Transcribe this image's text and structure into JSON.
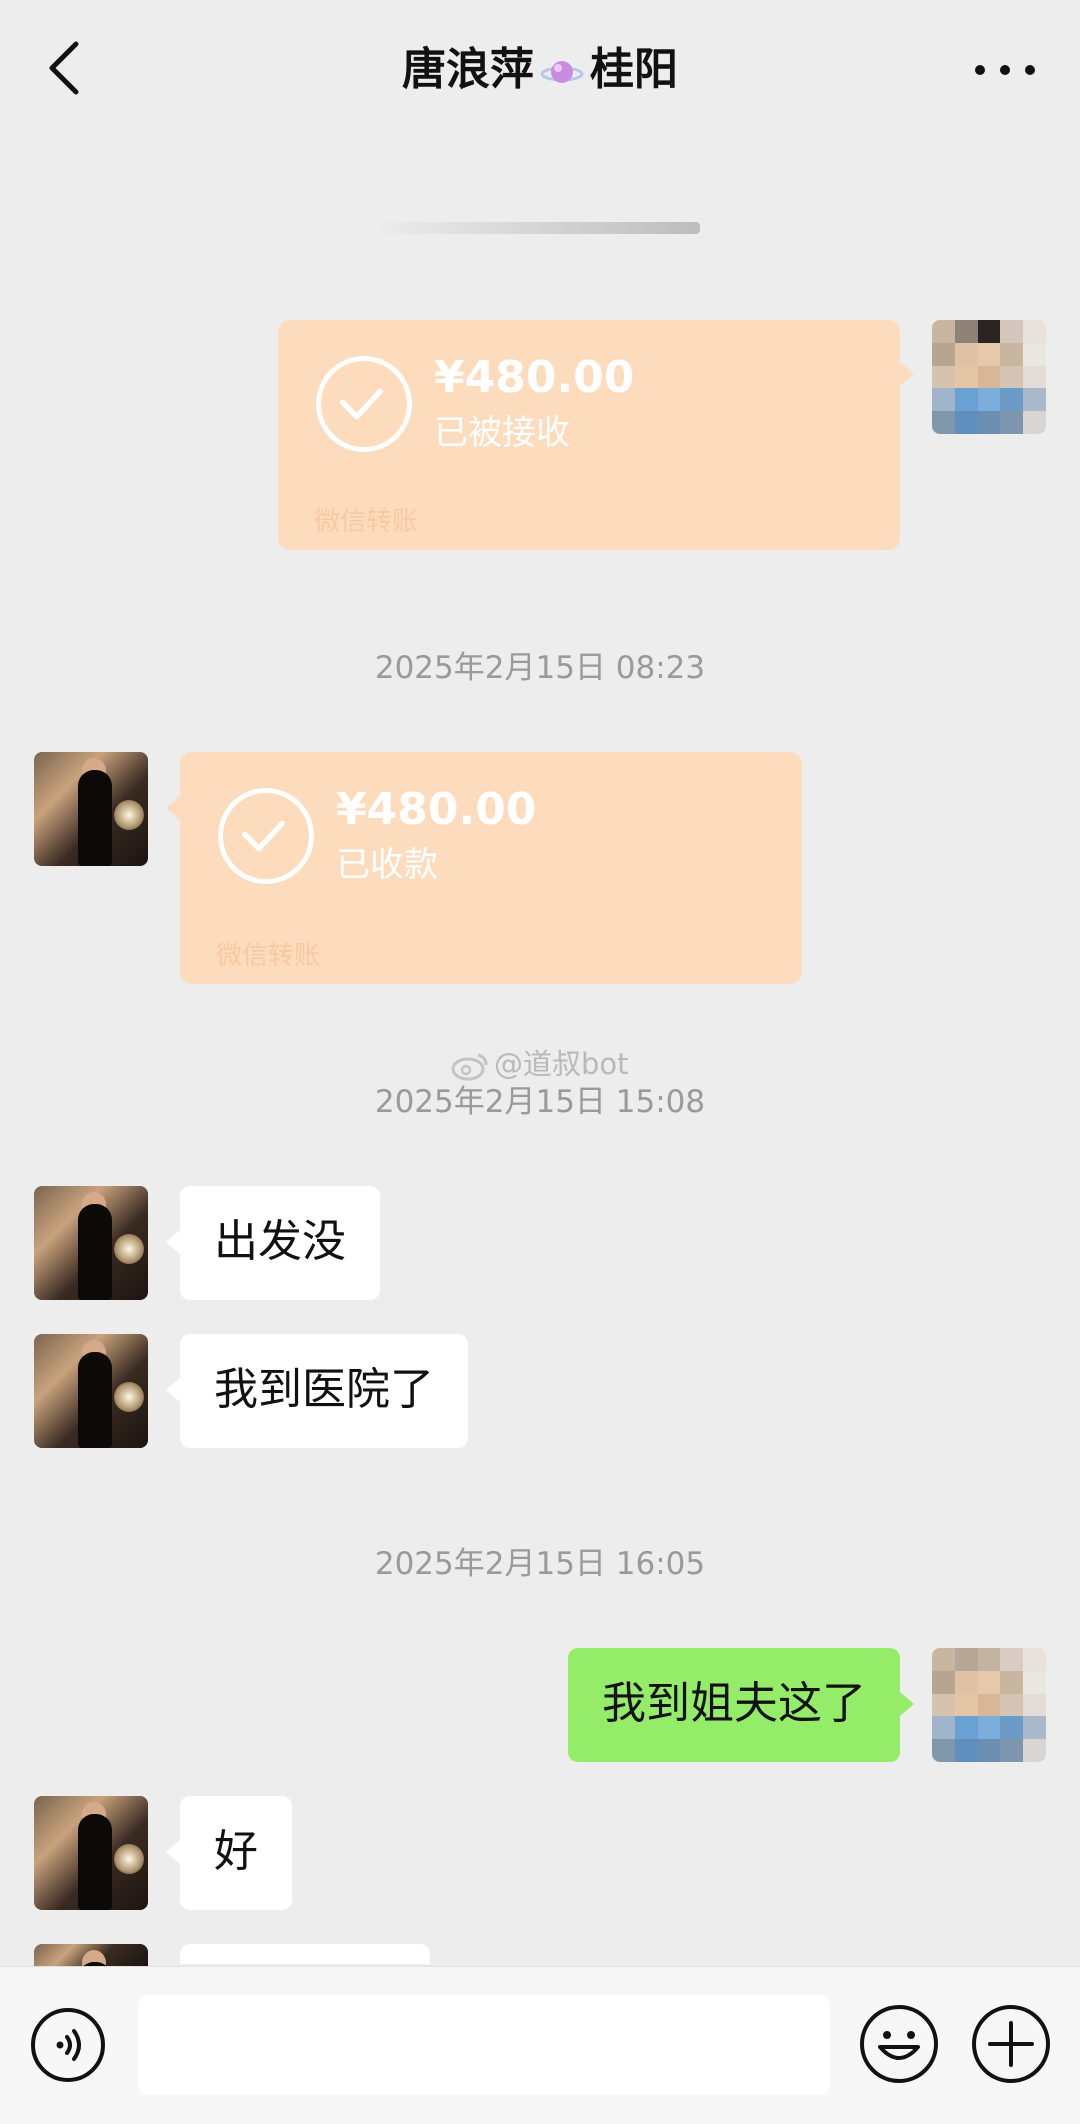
{
  "header": {
    "title_name": "唐浪萍",
    "title_city": "桂阳",
    "back_icon": "chevron-left-icon",
    "more_icon": "more-dots-icon",
    "title_icon": "planet-sticker-icon"
  },
  "messages": {
    "transfer_sent": {
      "amount": "¥480.00",
      "status": "已被接收",
      "footer": "微信转账"
    },
    "time_1": "2025年2月15日 08:23",
    "transfer_received": {
      "amount": "¥480.00",
      "status": "已收款",
      "footer": "微信转账"
    },
    "watermark": "@道叔bot",
    "time_2": "2025年2月15日 15:08",
    "msg_1": "出发没",
    "msg_2": "我到医院了",
    "time_3": "2025年2月15日 16:05",
    "msg_3": "我到姐夫这了",
    "msg_4": "好"
  },
  "input_bar": {
    "voice_icon": "voice-icon",
    "emoji_icon": "emoji-icon",
    "plus_icon": "plus-icon",
    "input_value": ""
  },
  "colors": {
    "background": "#ededed",
    "green_bubble": "#95ec69",
    "transfer_bubble": "#fddcbd",
    "timestamp": "#9a9a9a"
  }
}
